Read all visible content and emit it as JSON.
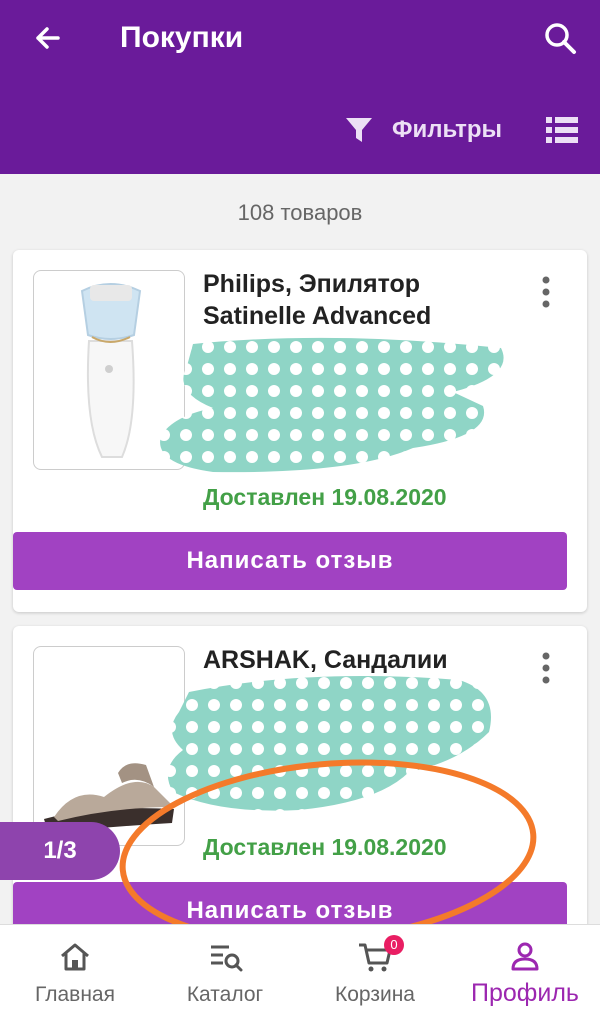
{
  "header": {
    "title": "Покупки",
    "filters_label": "Фильтры"
  },
  "items_count": "108 товаров",
  "orders": [
    {
      "name": "Philips, Эпилятор Satinelle Advanced",
      "status": "Доставлен 19.08.2020",
      "review_label": "Написать отзыв"
    },
    {
      "name": "ARSHAK, Сандалии",
      "status": "Доставлен 19.08.2020",
      "review_label": "Написать отзыв"
    }
  ],
  "pager": "1/3",
  "bottom_nav": [
    {
      "label": "Главная",
      "icon": "home-icon",
      "active": false
    },
    {
      "label": "Каталог",
      "icon": "catalog-icon",
      "active": false
    },
    {
      "label": "Корзина",
      "icon": "cart-icon",
      "active": false,
      "badge": "0"
    },
    {
      "label": "Профиль",
      "icon": "profile-icon",
      "active": true
    }
  ],
  "colors": {
    "appbar": "#6a1b9a",
    "accent": "#a142c2",
    "status_green": "#43a047",
    "censor": "#8fd5c6",
    "annotation": "#f47a2a"
  }
}
